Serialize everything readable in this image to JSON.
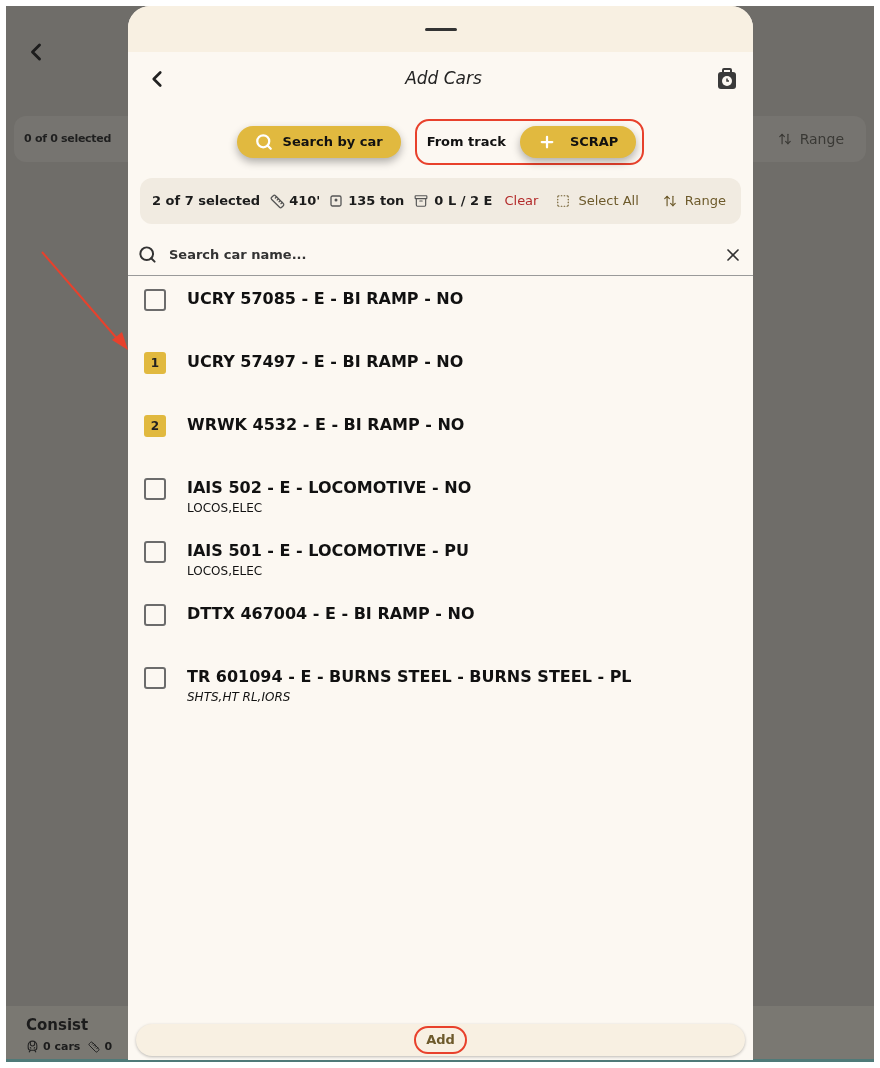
{
  "background": {
    "selection": "0 of 0 selected",
    "range": "Range",
    "consist": {
      "title": "Consist",
      "cars": "0 cars",
      "length": "0"
    }
  },
  "sheet": {
    "title": "Add Cars",
    "search_by_car": "Search by car",
    "from_track": {
      "label": "From track",
      "track": "SCRAP"
    },
    "stats": {
      "selected": "2 of 7 selected",
      "length": "410'",
      "weight": "135 ton",
      "loads": "0 L / 2 E",
      "clear": "Clear",
      "select_all": "Select All",
      "range": "Range"
    },
    "search": {
      "placeholder": "Search car name..."
    },
    "cars": [
      {
        "name": "UCRY 57085 - E - BI RAMP - NO",
        "selected": false
      },
      {
        "name": "UCRY 57497 - E - BI RAMP - NO",
        "selected": true,
        "order": "1"
      },
      {
        "name": "WRWK 4532 - E - BI RAMP - NO",
        "selected": true,
        "order": "2"
      },
      {
        "name": "IAIS 502 - E - LOCOMOTIVE - NO",
        "selected": false,
        "detail": "LOCOS,ELEC",
        "detail_italic": false
      },
      {
        "name": "IAIS 501 - E - LOCOMOTIVE - PU",
        "selected": false,
        "detail": "LOCOS,ELEC",
        "detail_italic": false
      },
      {
        "name": "DTTX 467004 - E - BI RAMP - NO",
        "selected": false
      },
      {
        "name": "TR 601094 - E - BURNS STEEL - BURNS STEEL - PL",
        "selected": false,
        "detail": "SHTS,HT RL,IORS",
        "detail_italic": true
      }
    ],
    "add": "Add"
  }
}
